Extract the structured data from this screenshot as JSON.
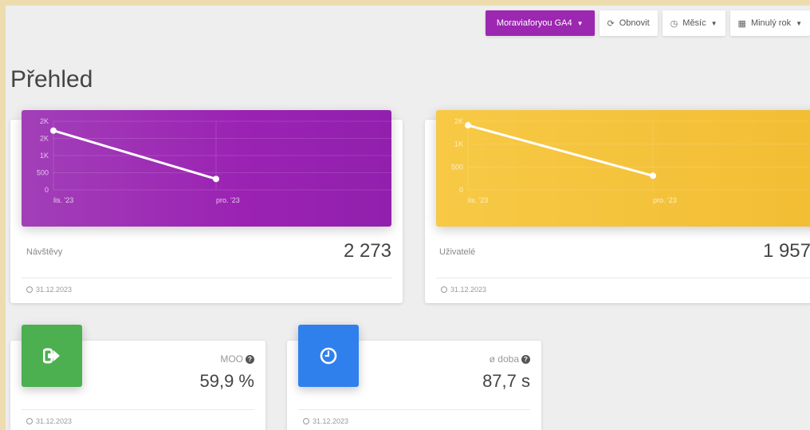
{
  "toolbar": {
    "property_label": "Moraviaforyou GA4",
    "refresh_label": "Obnovit",
    "granularity_label": "Měsíc",
    "range_label": "Minulý rok"
  },
  "page": {
    "title": "Přehled"
  },
  "cards": {
    "visits": {
      "label": "Návštěvy",
      "value": "2 273",
      "date": "31.12.2023"
    },
    "users": {
      "label": "Uživatelé",
      "value": "1 957",
      "date": "31.12.2023"
    },
    "bounce": {
      "label": "MOO",
      "value": "59,9 %",
      "date": "31.12.2023"
    },
    "duration": {
      "label": "ø doba",
      "value": "87,7 s",
      "date": "31.12.2023"
    }
  },
  "colors": {
    "purple": "#9c27b0",
    "yellow": "#f4c23a",
    "green": "#4caf50",
    "blue": "#2f80ed"
  },
  "chart_data": [
    {
      "type": "line",
      "categories": [
        "lis. '23",
        "pro. '23"
      ],
      "values": [
        1900,
        350
      ],
      "yticks": [
        "0",
        "500",
        "1K",
        "2K",
        "2K"
      ],
      "ylim": [
        0,
        2200
      ]
    },
    {
      "type": "line",
      "categories": [
        "lis. '23",
        "pro. '23"
      ],
      "values": [
        1600,
        350
      ],
      "yticks": [
        "0",
        "500",
        "1K",
        "2K"
      ],
      "ylim": [
        0,
        1700
      ]
    }
  ]
}
